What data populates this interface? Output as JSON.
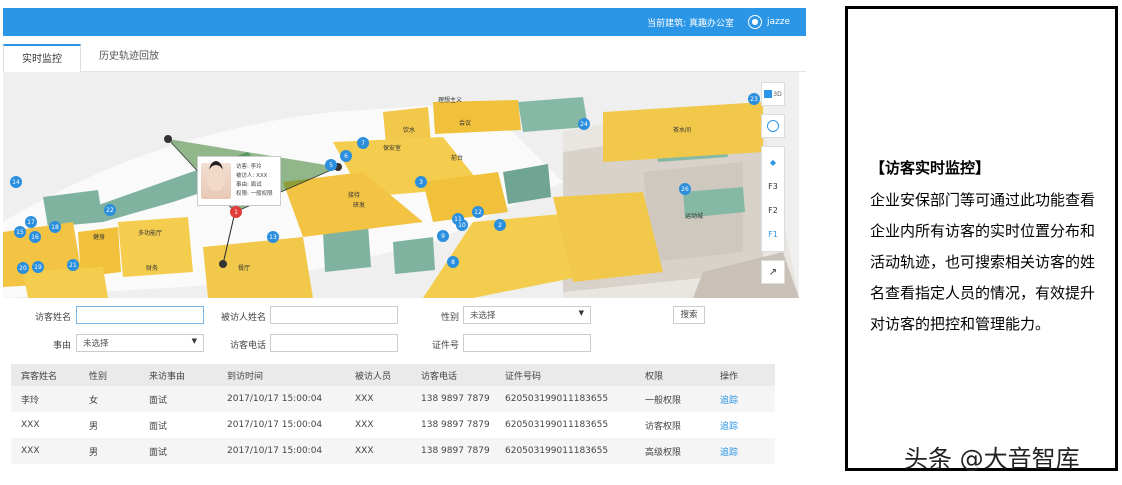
{
  "header": {
    "building_label": "当前建筑: 真趣办公室",
    "username": "jazze",
    "colors": {
      "brand": "#2b96e6"
    }
  },
  "tabs": [
    {
      "label": "实时监控",
      "active": true
    },
    {
      "label": "历史轨迹回放",
      "active": false
    }
  ],
  "map": {
    "controls": {
      "three_d": "3D",
      "floors": [
        "F3",
        "F2",
        "F1"
      ],
      "active_floor": "F1"
    },
    "info_card": {
      "name": "访客: 李玲",
      "visitee": "被访人: XXX",
      "reason": "事由: 面试",
      "permission": "权限: 一般权限"
    },
    "markers": [
      "1",
      "2",
      "3",
      "4",
      "5",
      "6",
      "7",
      "8",
      "9",
      "10",
      "11",
      "12",
      "13",
      "14",
      "15",
      "16",
      "17",
      "18",
      "19",
      "20",
      "21",
      "22",
      "23",
      "24",
      "26"
    ],
    "room_labels": [
      "理想主义",
      "会议",
      "保安室",
      "饮水",
      "前台",
      "接待",
      "茶水间",
      "研发",
      "运动城",
      "餐厅",
      "多功能厅",
      "健身",
      "财务"
    ]
  },
  "search": {
    "visitor_name_label": "访客姓名",
    "visitor_name_value": "",
    "visitee_name_label": "被访人姓名",
    "visitee_name_value": "",
    "gender_label": "性别",
    "gender_value": "未选择",
    "search_button": "搜索",
    "reason_label": "事由",
    "reason_value": "未选择",
    "phone_label": "访客电话",
    "phone_value": "",
    "id_label": "证件号",
    "id_value": ""
  },
  "table": {
    "headers": [
      "宾客姓名",
      "性别",
      "来访事由",
      "到访时间",
      "被访人员",
      "访客电话",
      "证件号码",
      "权限",
      "操作"
    ],
    "rows": [
      [
        "李玲",
        "女",
        "面试",
        "2017/10/17 15:00:04",
        "XXX",
        "138 9897 7879",
        "620503199011183655",
        "一般权限",
        "追踪"
      ],
      [
        "XXX",
        "男",
        "面试",
        "2017/10/17 15:00:04",
        "XXX",
        "138 9897 7879",
        "620503199011183655",
        "访客权限",
        "追踪"
      ],
      [
        "XXX",
        "男",
        "面试",
        "2017/10/17 15:00:04",
        "XXX",
        "138 9897 7879",
        "620503199011183655",
        "高级权限",
        "追踪"
      ]
    ]
  },
  "panel": {
    "title": "【访客实时监控】",
    "body": "企业安保部门等可通过此功能查看企业内所有访客的实时位置分布和活动轨迹，也可搜索相关访客的姓名查看指定人员的情况，有效提升对访客的把控和管理能力。",
    "watermark": "头条 @大音智库"
  }
}
